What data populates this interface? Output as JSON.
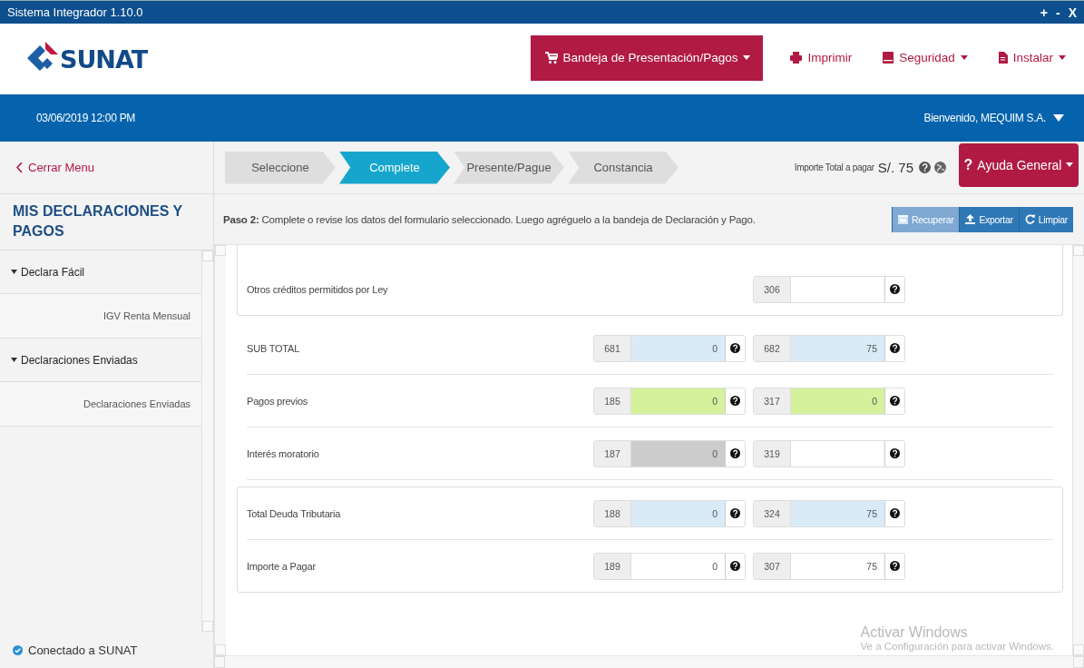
{
  "window": {
    "title": "Sistema Integrador 1.10.0",
    "controls": [
      "+",
      "-",
      "X"
    ]
  },
  "header": {
    "logo": "SUNAT",
    "menu": [
      {
        "label": "Bandeja de Presentación/Pagos",
        "dropdown": true,
        "selected": true
      },
      {
        "label": "Imprimir",
        "dropdown": false,
        "selected": false
      },
      {
        "label": "Seguridad",
        "dropdown": true,
        "selected": false
      },
      {
        "label": "Instalar",
        "dropdown": true,
        "selected": false
      }
    ]
  },
  "infobar": {
    "datetime": "03/06/2019 12:00 PM",
    "welcome": "Bienvenido, MEQUIM S.A."
  },
  "sidebar": {
    "close": "Cerrar Menu",
    "title": "MIS DECLARACIONES Y PAGOS",
    "items": [
      {
        "label": "Declara Fácil",
        "expanded": true,
        "children": [
          {
            "label": "IGV Renta Mensual"
          }
        ]
      },
      {
        "label": "Declaraciones Enviadas",
        "expanded": true,
        "children": [
          {
            "label": "Declaraciones Enviadas"
          }
        ]
      }
    ],
    "status": "Conectado a SUNAT"
  },
  "steps": [
    {
      "label": "Seleccione",
      "selected": false
    },
    {
      "label": "Complete",
      "selected": true
    },
    {
      "label": "Presente/Pague",
      "selected": false
    },
    {
      "label": "Constancia",
      "selected": false
    }
  ],
  "total": {
    "label": "Importe Total a pagar",
    "amount": "S/. 75"
  },
  "help_button": {
    "icon": "?",
    "label": "Ayuda General"
  },
  "instruction": {
    "step": "Paso 2:",
    "text": "Complete o revise los datos del formulario seleccionado. Luego agréguelo a la bandeja de Declaración y Pago."
  },
  "actions": [
    {
      "label": "Recuperar",
      "disabled": true
    },
    {
      "label": "Exportar",
      "disabled": false
    },
    {
      "label": "Limpiar",
      "disabled": false
    }
  ],
  "form": {
    "sections": [
      {
        "boxed": true,
        "rows": [
          {
            "label": "Otros créditos permitidos por Ley",
            "fields": [
              {
                "code": "306",
                "color": "#ffffff"
              }
            ]
          }
        ]
      },
      {
        "boxed": false,
        "rows": [
          {
            "label": "SUB TOTAL",
            "fields": [
              {
                "code": "681",
                "value": "0",
                "color": "#d9ebf7"
              },
              {
                "code": "682",
                "value": "75",
                "color": "#d9ebf7"
              }
            ]
          },
          {
            "label": "Pagos previos",
            "fields": [
              {
                "code": "185",
                "value": "0",
                "color": "#d6f19b"
              },
              {
                "code": "317",
                "value": "0",
                "color": "#d6f19b"
              }
            ]
          },
          {
            "label": "Interés moratorio",
            "fields": [
              {
                "code": "187",
                "value": "0",
                "color": "#cccccc"
              },
              {
                "code": "319",
                "color": "#ffffff"
              }
            ]
          }
        ]
      },
      {
        "boxed": true,
        "rows": [
          {
            "label": "Total Deuda Tributaria",
            "fields": [
              {
                "code": "188",
                "value": "0",
                "color": "#d9ebf7"
              },
              {
                "code": "324",
                "value": "75",
                "color": "#d9ebf7"
              }
            ]
          },
          {
            "label": "Importe a Pagar",
            "fields": [
              {
                "code": "189",
                "value": "0",
                "color": "#ffffff"
              },
              {
                "code": "307",
                "value": "75",
                "color": "#ffffff"
              }
            ]
          }
        ]
      }
    ]
  },
  "os_notice": {
    "title": "Activar Windows",
    "text": "Ve a Configuración para activar Windows."
  }
}
